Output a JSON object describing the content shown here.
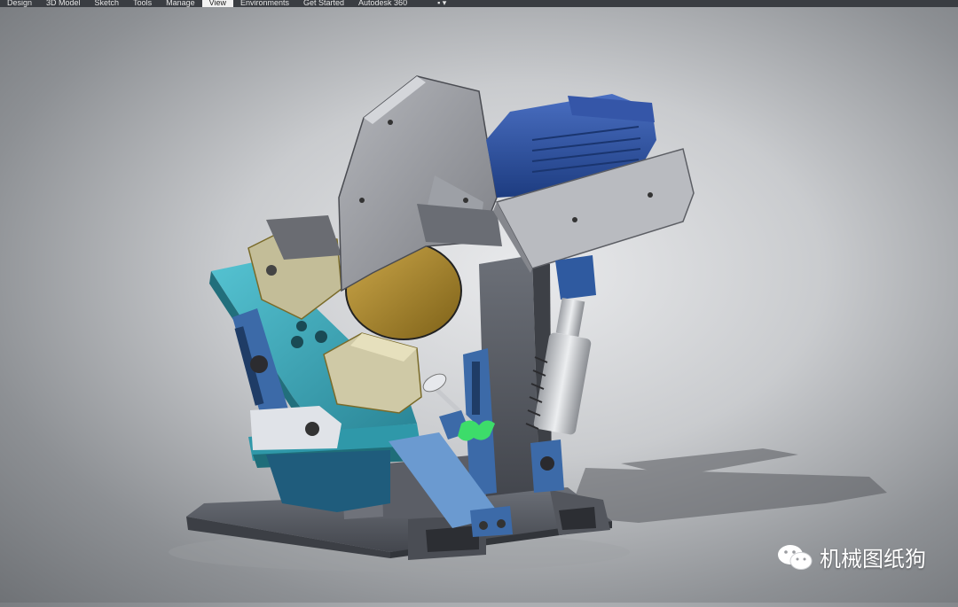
{
  "ribbon": {
    "tabs": [
      {
        "label": "Design",
        "active": false
      },
      {
        "label": "3D Model",
        "active": false
      },
      {
        "label": "Sketch",
        "active": false
      },
      {
        "label": "Tools",
        "active": false
      },
      {
        "label": "Manage",
        "active": false
      },
      {
        "label": "View",
        "active": true
      },
      {
        "label": "Environments",
        "active": false
      },
      {
        "label": "Get Started",
        "active": false
      },
      {
        "label": "Autodesk 360",
        "active": false
      }
    ],
    "extra_icon": "camera-dropdown-icon"
  },
  "viewport": {
    "model_description_icon": "cutoff-saw-3d-model",
    "colors": {
      "guard": "#8e9096",
      "motor": "#2b4f9c",
      "table": "#3aa7b8",
      "frame": "#5d6068",
      "blade": "#b5912e",
      "fixture": "#c8c2a0",
      "knob": "#3ddc6a"
    }
  },
  "watermark": {
    "text": "机械图纸狗",
    "icon": "wechat-icon"
  }
}
